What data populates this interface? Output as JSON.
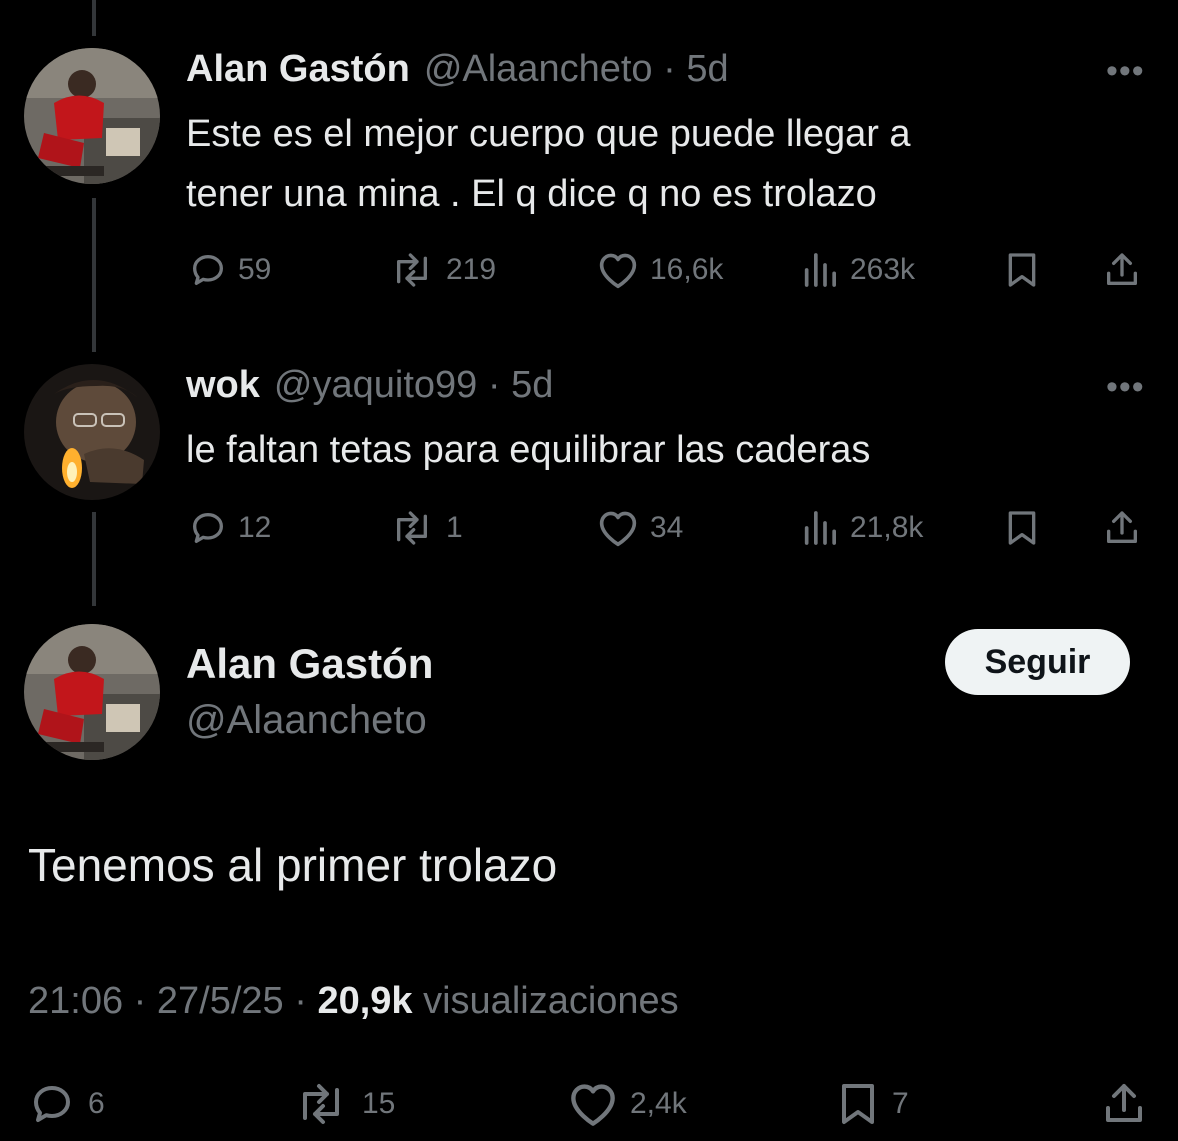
{
  "tweets": [
    {
      "name": "Alan Gastón",
      "handle": "@Alaancheto",
      "time": "5d",
      "text_lines": [
        "Este es el mejor cuerpo que puede llegar a",
        "tener una mina . El q dice q no es trolazo"
      ],
      "replies": "59",
      "retweets": "219",
      "likes": "16,6k",
      "views": "263k"
    },
    {
      "name": "wok",
      "handle": "@yaquito99",
      "time": "5d",
      "text_lines": [
        "le faltan tetas para equilibrar las caderas"
      ],
      "replies": "12",
      "retweets": "1",
      "likes": "34",
      "views": "21,8k"
    }
  ],
  "main": {
    "name": "Alan Gastón",
    "handle": "@Alaancheto",
    "follow_label": "Seguir",
    "text": "Tenemos al primer trolazo",
    "time": "21:06",
    "date": "27/5/25",
    "views_count": "20,9k",
    "views_label": "visualizaciones",
    "replies": "6",
    "retweets": "15",
    "likes": "2,4k",
    "bookmarks": "7"
  },
  "colors": {
    "background": "#000000",
    "text": "#e7e9ea",
    "muted": "#71767b",
    "button_bg": "#eff3f4"
  },
  "icons": {
    "reply": "reply-icon",
    "retweet": "retweet-icon",
    "like": "heart-icon",
    "views": "views-icon",
    "bookmark": "bookmark-icon",
    "share": "share-icon",
    "more": "more-icon"
  }
}
